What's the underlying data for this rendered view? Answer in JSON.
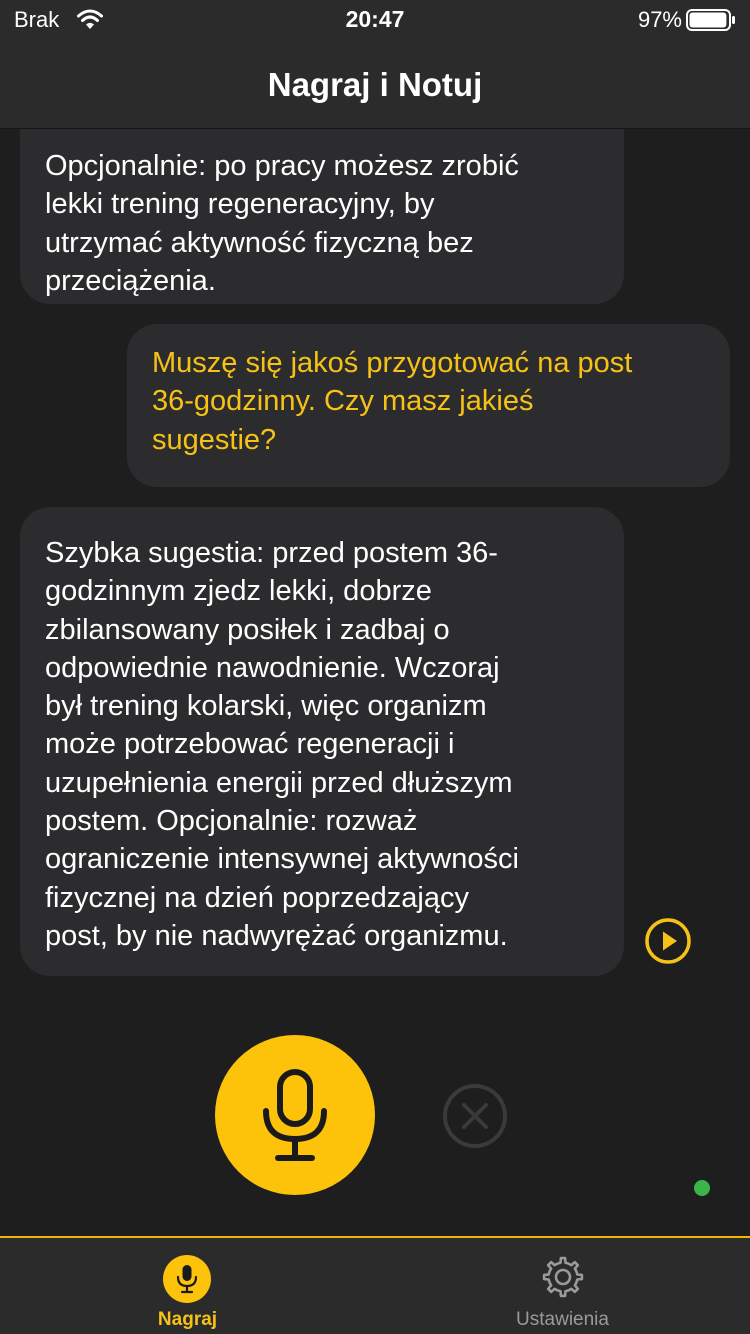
{
  "status_bar": {
    "carrier": "Brak",
    "time": "20:47",
    "battery_percent": "97%",
    "battery_level": 0.97
  },
  "nav": {
    "title": "Nagraj i Notuj"
  },
  "messages": [
    {
      "role": "assistant",
      "text": "Opcjonalnie: po pracy możesz zrobić\nlekki trening regeneracyjny, by\nutrzymać aktywność fizyczną bez\nprzeciążenia."
    },
    {
      "role": "user",
      "text": "Muszę się jakoś przygotować na post\n36-godzinny. Czy masz jakieś\nsugestie?"
    },
    {
      "role": "assistant",
      "text": "Szybka sugestia: przed postem 36-\ngodzinnym zjedz lekki, dobrze\nzbilansowany posiłek i zadbaj o\nodpowiednie nawodnienie. Wczoraj\nbył trening kolarski, więc organizm\nmoże potrzebować regeneracji i\nuzupełnienia energii przed dłuższym\npostem. Opcjonalnie: rozważ\nograniczenie intensywnej aktywności\nfizycznej na dzień poprzedzający\npost, by nie nadwyrężać organizmu."
    }
  ],
  "controls": {
    "play_icon": "play-circle-icon",
    "mic_icon": "microphone-icon",
    "cancel_icon": "close-circle-icon"
  },
  "tabs": [
    {
      "label": "Nagraj",
      "icon": "microphone-icon",
      "active": true
    },
    {
      "label": "Ustawienia",
      "icon": "gear-icon",
      "active": false
    }
  ],
  "colors": {
    "accent": "#fcc30a",
    "user_text": "#f6c215",
    "background": "#1e1e1e",
    "bubble": "#2c2c2e",
    "status_dot": "#39b54a"
  }
}
